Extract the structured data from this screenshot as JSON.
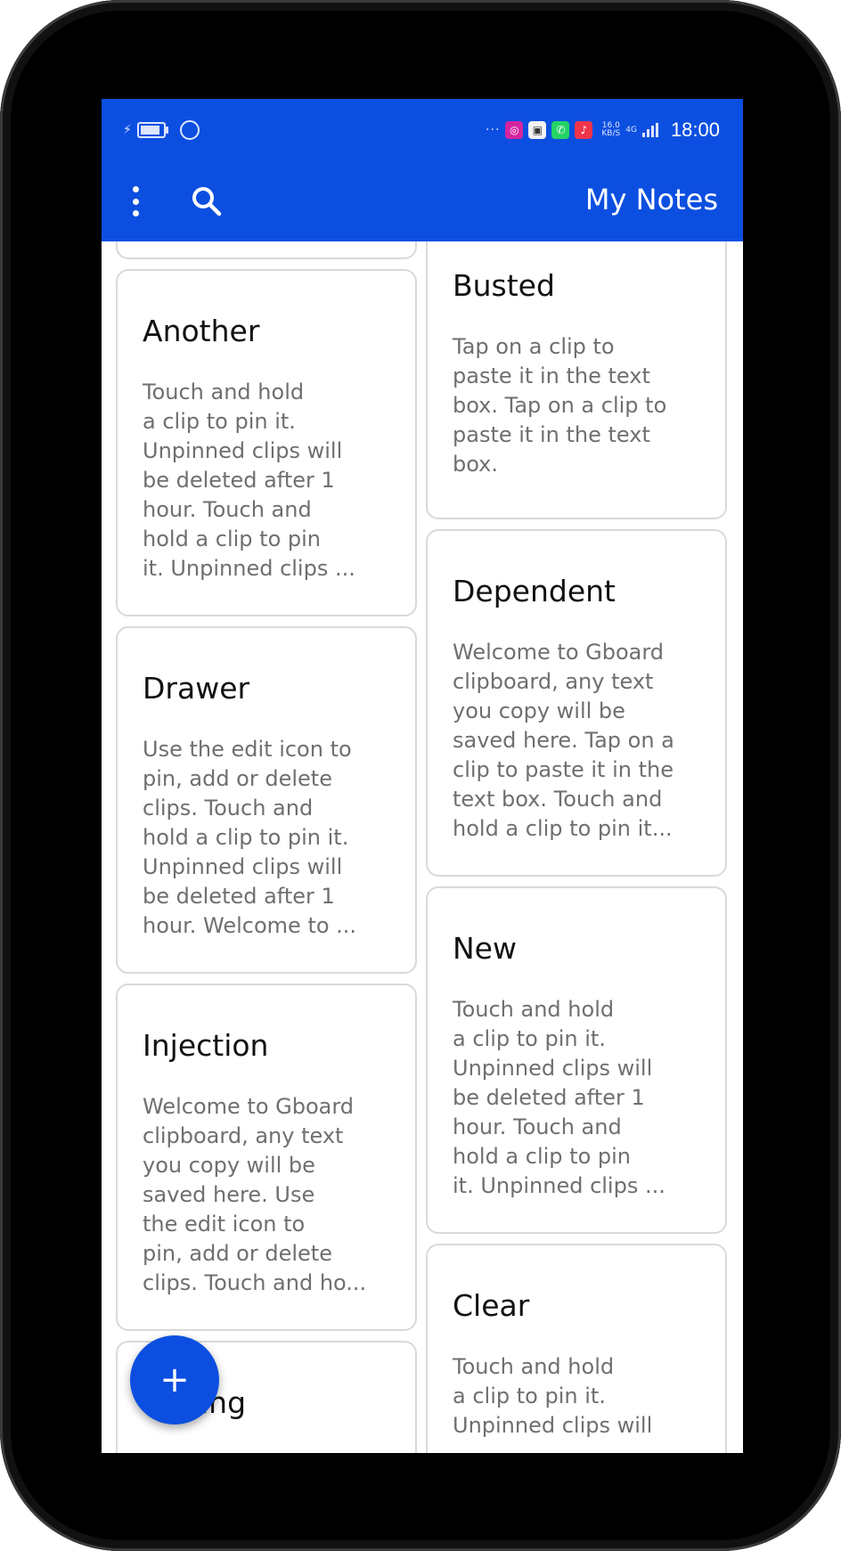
{
  "status_bar": {
    "time": "18:00",
    "speed_top": "16.0",
    "speed_unit": "KB/S",
    "network": "4G",
    "more_glyph": "···",
    "icons": [
      "charging-icon",
      "battery-icon",
      "alarm-icon",
      "instagram-icon",
      "bot-icon",
      "whatsapp-icon",
      "music-icon",
      "signal-icon"
    ],
    "battery_level": 0.75
  },
  "app_bar": {
    "title": "My Notes",
    "menu_icon": "more-vertical-icon",
    "search_icon": "search-icon"
  },
  "colors": {
    "primary": "#0c4fe0",
    "card_border": "#d9d9d9",
    "title_text": "#111111",
    "body_text": "#6f6f6f"
  },
  "notes_left": [
    {
      "title": "",
      "body": ""
    },
    {
      "title": "Another",
      "body": "Touch and hold\na clip to pin it.\nUnpinned clips will\nbe deleted after 1\nhour. Touch and\nhold a clip to pin\nit.  Unpinned clips ..."
    },
    {
      "title": "Drawer",
      "body": "Use the edit icon to\npin,  add or delete\nclips. Touch and\nhold a clip to pin it.\nUnpinned clips will\nbe deleted after 1\nhour. Welcome to ..."
    },
    {
      "title": "Injection",
      "body": "Welcome to Gboard\nclipboard,  any text\nyou copy will be\nsaved here. Use\nthe edit icon to\npin,  add or delete\nclips. Touch and ho..."
    },
    {
      "title": "Testing",
      "body": ""
    }
  ],
  "notes_right": [
    {
      "title": "Busted",
      "body": "Tap on a clip to\npaste it in the text\nbox. Tap on a clip to\npaste it in the text\nbox."
    },
    {
      "title": "Dependent",
      "body": "Welcome to Gboard\nclipboard,  any text\nyou copy will be\nsaved here. Tap on a\nclip to paste it in the\ntext box. Touch and\nhold a clip to pin it..."
    },
    {
      "title": "New",
      "body": "Touch and hold\na clip to pin it.\nUnpinned clips will\nbe deleted after 1\nhour. Touch and\nhold a clip to pin\nit.  Unpinned clips ..."
    },
    {
      "title": "Clear",
      "body": "Touch and hold\na clip to pin it.\nUnpinned clips will"
    }
  ],
  "fab": {
    "label": "+",
    "icon": "add-icon"
  }
}
